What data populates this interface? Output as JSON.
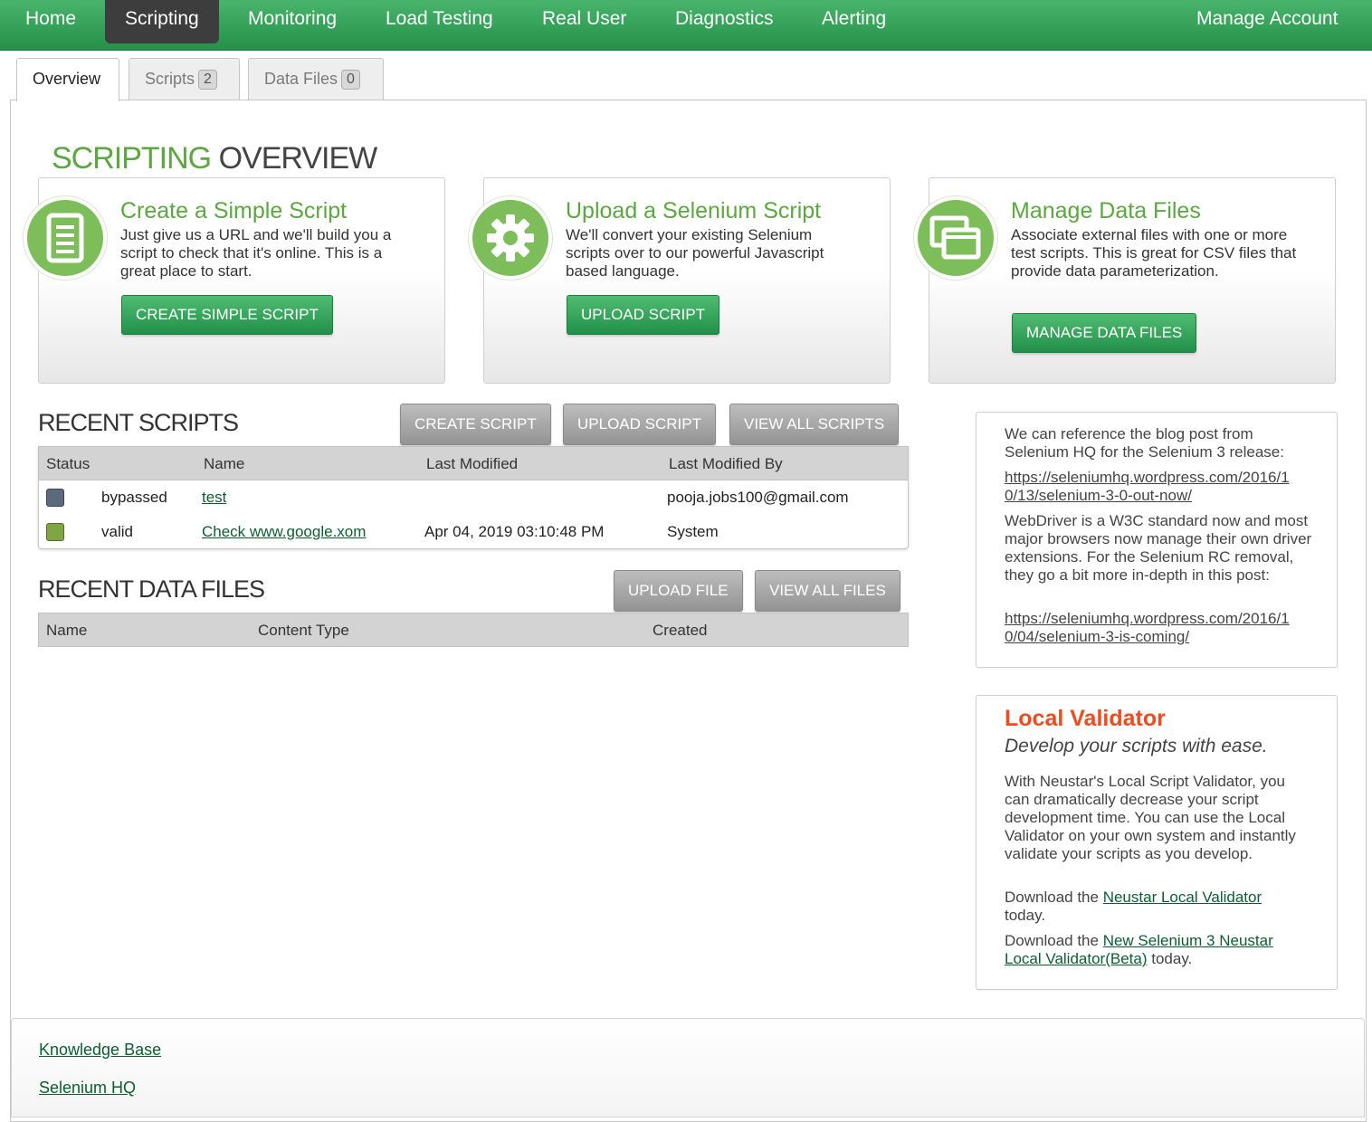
{
  "nav": {
    "items": [
      {
        "label": "Home"
      },
      {
        "label": "Scripting"
      },
      {
        "label": "Monitoring"
      },
      {
        "label": "Load Testing"
      },
      {
        "label": "Real User"
      },
      {
        "label": "Diagnostics"
      },
      {
        "label": "Alerting"
      }
    ],
    "active": "Scripting",
    "account": "Manage Account"
  },
  "tabs": [
    {
      "label": "Overview",
      "count": null
    },
    {
      "label": "Scripts",
      "count": "2"
    },
    {
      "label": "Data Files",
      "count": "0"
    }
  ],
  "page": {
    "title_part1": "SCRIPTING",
    "title_part2": "OVERVIEW"
  },
  "cards": [
    {
      "icon": "document-icon",
      "title": "Create a Simple Script",
      "description": "Just give us a URL and we'll build you a script to check that it's online. This is a great place to start.",
      "button": "CREATE SIMPLE SCRIPT"
    },
    {
      "icon": "gear-icon",
      "title": "Upload a Selenium Script",
      "description": "We'll convert your existing Selenium scripts over to our powerful Javascript based language.",
      "button": "UPLOAD SCRIPT"
    },
    {
      "icon": "windows-icon",
      "title": "Manage Data Files",
      "description": "Associate external files with one or more test scripts. This is great for CSV files that provide data parameterization.",
      "button": "MANAGE DATA FILES"
    }
  ],
  "recent_scripts": {
    "title": "RECENT SCRIPTS",
    "buttons": {
      "create": "CREATE SCRIPT",
      "upload": "UPLOAD SCRIPT",
      "view_all": "VIEW ALL SCRIPTS"
    },
    "columns": [
      "Status",
      "Name",
      "Last Modified",
      "Last Modified By"
    ],
    "rows": [
      {
        "status": "bypassed",
        "status_color": "#5b6b7d",
        "name": "test",
        "last_modified": "",
        "modified_by": "pooja.jobs100@gmail.com"
      },
      {
        "status": "valid",
        "status_color": "#7fa642",
        "name": "Check www.google.xom",
        "last_modified": "Apr 04, 2019 03:10:48 PM",
        "modified_by": "System"
      }
    ]
  },
  "recent_data_files": {
    "title": "RECENT DATA FILES",
    "buttons": {
      "upload": "UPLOAD FILE",
      "view_all": "VIEW ALL FILES"
    },
    "columns": [
      "Name",
      "Content Type",
      "Created"
    ]
  },
  "blog_box": {
    "text1": "We can reference the blog post from Selenium HQ for the Selenium 3 release:",
    "link1": "https://seleniumhq.wordpress.com/2016/10/13/selenium-3-0-out-now/",
    "link1_line1": "https://seleniumhq.wordpress.com/2016/1",
    "link1_line2": "0/13/selenium-3-0-out-now/",
    "text2": "WebDriver is a W3C standard now and most major browsers now manage their own driver extensions. For the Selenium RC removal, they go a bit more in-depth in this post:",
    "link2": "https://seleniumhq.wordpress.com/2016/10/04/selenium-3-is-coming/",
    "link2_line1": "https://seleniumhq.wordpress.com/2016/1",
    "link2_line2": "0/04/selenium-3-is-coming/"
  },
  "validator_box": {
    "title": "Local Validator",
    "subtitle": "Develop your scripts with ease.",
    "body": "With Neustar's Local Script Validator, you can dramatically decrease your script development time. You can use the Local Validator on your own system and instantly validate your scripts as you develop.",
    "download1_prefix": "Download the",
    "download1_link": "Neustar Local Validator",
    "download1_suffix": "today.",
    "download2_prefix": "Download the",
    "download2_link_line1": "New Selenium 3 Neustar",
    "download2_link_line2": "Local Validator(Beta)",
    "download2_suffix": "today."
  },
  "footer": {
    "links": [
      "Knowledge Base",
      "Selenium HQ"
    ]
  },
  "colors": {
    "brand_green": "#2a9a4f",
    "title_green": "#5aa83f",
    "validator_orange": "#ef4b1f",
    "link_green": "#0b5e2f"
  }
}
